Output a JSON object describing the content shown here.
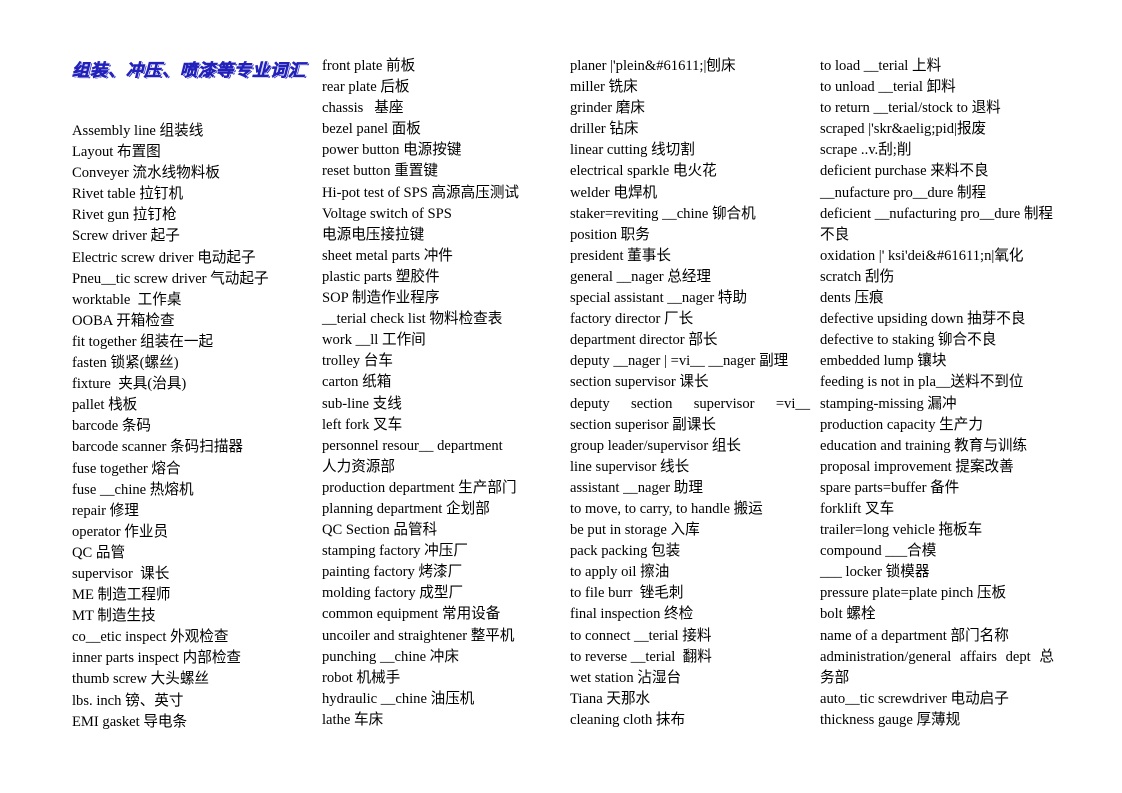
{
  "document": {
    "title": "组装、冲压、喷漆等专业词汇",
    "title_color": "#3333cc",
    "page_background": "#ffffff",
    "text_color": "#000000"
  },
  "columns": [
    {
      "id": "column-1",
      "entries": [
        "Assembly line 组装线",
        "Layout 布置图",
        "Conveyer 流水线物料板",
        "Rivet table 拉钉机",
        "Rivet gun 拉钉枪",
        "Screw driver 起子",
        "Electric screw driver 电动起子",
        "Pneu__tic screw driver 气动起子",
        "worktable  工作桌",
        "OOBA 开箱检查",
        "fit together 组装在一起",
        "fasten 锁紧(螺丝)",
        "fixture  夹具(治具)",
        "pallet 栈板",
        "barcode 条码",
        "barcode scanner 条码扫描器",
        "fuse together 熔合",
        "fuse __chine 热熔机",
        "repair 修理",
        "operator 作业员",
        "QC 品管",
        "supervisor  课长",
        "ME 制造工程师",
        "MT 制造生技",
        "co__etic inspect 外观检查",
        "inner parts inspect 内部检查",
        "thumb screw 大头螺丝",
        "lbs. inch 镑、英寸",
        "EMI gasket 导电条"
      ]
    },
    {
      "id": "column-2",
      "entries": [
        "front plate 前板",
        "rear plate 后板",
        "chassis   基座",
        "bezel panel 面板",
        "power button 电源按键",
        "reset button 重置键",
        "Hi-pot test of SPS 高源高压测试",
        "Voltage switch of SPS",
        "电源电压接拉键",
        "sheet metal parts 冲件",
        "plastic parts 塑胶件",
        "SOP 制造作业程序",
        "__terial check list 物料检查表",
        "work __ll 工作间",
        "trolley 台车",
        "carton 纸箱",
        "sub-line 支线",
        "left fork 叉车",
        "personnel resour__ department",
        "人力资源部",
        "production department 生产部门",
        "planning department 企划部",
        "QC Section 品管科",
        "stamping factory 冲压厂",
        "painting factory 烤漆厂",
        "molding factory 成型厂",
        "common equipment 常用设备",
        "uncoiler and straightener 整平机",
        "punching __chine 冲床",
        "robot 机械手",
        "hydraulic __chine 油压机",
        "lathe 车床"
      ]
    },
    {
      "id": "column-3",
      "entries": [
        "planer |'plein&#61611;|刨床",
        "miller 铣床",
        "grinder 磨床",
        "driller 钻床",
        "linear cutting 线切割",
        "electrical sparkle 电火花",
        "welder 电焊机",
        "staker=reviting __chine 铆合机",
        "position 职务",
        "president 董事长",
        "general __nager 总经理",
        "special assistant __nager 特助",
        "factory director 厂长",
        "department director 部长",
        "deputy __nager | =vi__ __nager 副理",
        "section supervisor 课长",
        "deputy section supervisor =vi__",
        "section superisor 副课长",
        "group leader/supervisor 组长",
        "line supervisor 线长",
        "assistant __nager 助理",
        "to move, to carry, to handle 搬运",
        "be put in storage 入库",
        "pack packing 包装",
        "to apply oil 擦油",
        "to file burr  锉毛刺",
        "final inspection 终检",
        "to connect __terial 接料",
        "to reverse __terial  翻料",
        "wet station 沾湿台",
        "Tiana 天那水",
        "cleaning cloth 抹布"
      ]
    },
    {
      "id": "column-4",
      "entries": [
        "to load __terial 上料",
        "to unload __terial 卸料",
        "to return __terial/stock to 退料",
        "scraped |'skr&aelig;pid|报废",
        "scrape ..v.刮;削",
        "deficient purchase 来料不良",
        "__nufacture pro__dure 制程",
        "deficient __nufacturing pro__dure 制程",
        "不良",
        "oxidation |' ksi'dei&#61611;n|氧化",
        "scratch 刮伤",
        "dents 压痕",
        "defective upsiding down 抽芽不良",
        "defective to staking 铆合不良",
        "embedded lump 镶块",
        "feeding is not in pla__送料不到位",
        "stamping-missing 漏冲",
        "production capacity 生产力",
        "education and training 教育与训练",
        "proposal improvement 提案改善",
        "spare parts=buffer 备件",
        "forklift 叉车",
        "trailer=long vehicle 拖板车",
        "compound ___合模",
        "___ locker 锁模器",
        "pressure plate=plate pinch 压板",
        "bolt 螺栓",
        "name of a department 部门名称",
        "administration/general affairs dept 总",
        "务部",
        "auto__tic screwdriver 电动启子",
        "thickness gauge 厚薄规"
      ]
    }
  ],
  "layout_flags": {
    "column_3_justified_index": 16,
    "column_4_justified_index": 28
  }
}
